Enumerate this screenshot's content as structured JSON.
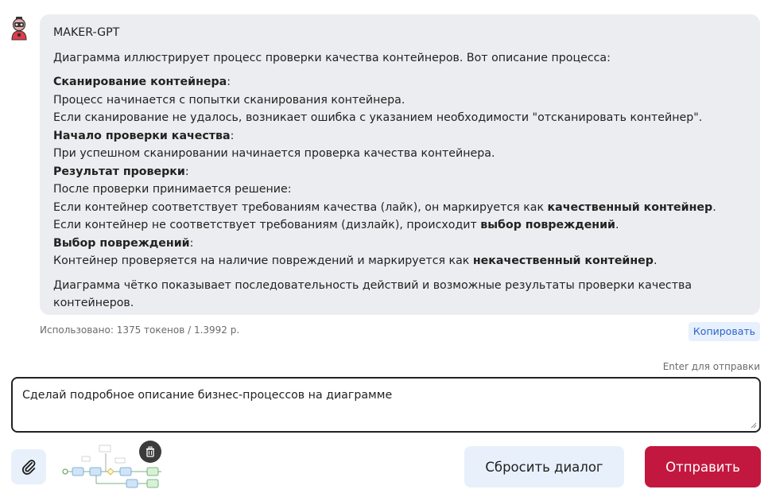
{
  "message": {
    "sender": "MAKER-GPT",
    "intro": "Диаграмма иллюстрирует процесс проверки качества контейнеров. Вот описание процесса:",
    "sections": [
      {
        "heading": "Сканирование контейнера",
        "lines": [
          "Процесс начинается с попытки сканирования контейнера.",
          "Если сканирование не удалось, возникает ошибка с указанием необходимости \"отсканировать контейнер\"."
        ]
      },
      {
        "heading": "Начало проверки качества",
        "lines": [
          "При успешном сканировании начинается проверка качества контейнера."
        ]
      },
      {
        "heading": "Результат проверки",
        "lines": [
          "После проверки принимается решение:"
        ],
        "rich_lines": [
          {
            "text": "Если контейнер соответствует требованиям качества (лайк), он маркируется как ",
            "bold": "качественный контейнер",
            "tail": "."
          },
          {
            "text": "Если контейнер не соответствует требованиям (дизлайк), происходит ",
            "bold": "выбор повреждений",
            "tail": "."
          }
        ]
      },
      {
        "heading": "Выбор повреждений",
        "rich_lines": [
          {
            "text": "Контейнер проверяется на наличие повреждений и маркируется как ",
            "bold": "некачественный контейнер",
            "tail": "."
          }
        ]
      }
    ],
    "conclusion": "Диаграмма чётко показывает последовательность действий и возможные результаты проверки качества контейнеров."
  },
  "usage": "Использовано: 1375 токенов / 1.3992 р.",
  "copy_label": "Копировать",
  "enter_hint": "Enter для отправки",
  "input_value": "Сделай подробное описание бизнес-процессов на диаграмме",
  "reset_label": "Сбросить диалог",
  "send_label": "Отправить",
  "colors": {
    "accent": "#c2183f",
    "bubble": "#ecedf0",
    "light_button": "#e8f0fb",
    "link": "#2d63c6"
  }
}
